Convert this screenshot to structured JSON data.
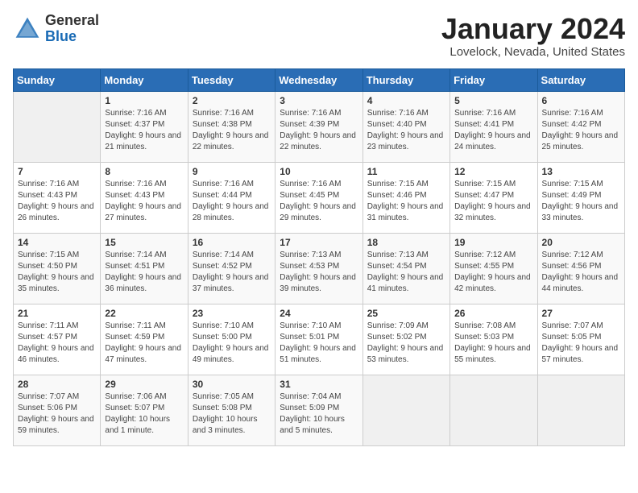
{
  "header": {
    "logo_general": "General",
    "logo_blue": "Blue",
    "month": "January 2024",
    "location": "Lovelock, Nevada, United States"
  },
  "days_of_week": [
    "Sunday",
    "Monday",
    "Tuesday",
    "Wednesday",
    "Thursday",
    "Friday",
    "Saturday"
  ],
  "weeks": [
    [
      {
        "day": "",
        "sunrise": "",
        "sunset": "",
        "daylight": ""
      },
      {
        "day": "1",
        "sunrise": "7:16 AM",
        "sunset": "4:37 PM",
        "daylight": "9 hours and 21 minutes."
      },
      {
        "day": "2",
        "sunrise": "7:16 AM",
        "sunset": "4:38 PM",
        "daylight": "9 hours and 22 minutes."
      },
      {
        "day": "3",
        "sunrise": "7:16 AM",
        "sunset": "4:39 PM",
        "daylight": "9 hours and 22 minutes."
      },
      {
        "day": "4",
        "sunrise": "7:16 AM",
        "sunset": "4:40 PM",
        "daylight": "9 hours and 23 minutes."
      },
      {
        "day": "5",
        "sunrise": "7:16 AM",
        "sunset": "4:41 PM",
        "daylight": "9 hours and 24 minutes."
      },
      {
        "day": "6",
        "sunrise": "7:16 AM",
        "sunset": "4:42 PM",
        "daylight": "9 hours and 25 minutes."
      }
    ],
    [
      {
        "day": "7",
        "sunrise": "7:16 AM",
        "sunset": "4:43 PM",
        "daylight": "9 hours and 26 minutes."
      },
      {
        "day": "8",
        "sunrise": "7:16 AM",
        "sunset": "4:43 PM",
        "daylight": "9 hours and 27 minutes."
      },
      {
        "day": "9",
        "sunrise": "7:16 AM",
        "sunset": "4:44 PM",
        "daylight": "9 hours and 28 minutes."
      },
      {
        "day": "10",
        "sunrise": "7:16 AM",
        "sunset": "4:45 PM",
        "daylight": "9 hours and 29 minutes."
      },
      {
        "day": "11",
        "sunrise": "7:15 AM",
        "sunset": "4:46 PM",
        "daylight": "9 hours and 31 minutes."
      },
      {
        "day": "12",
        "sunrise": "7:15 AM",
        "sunset": "4:47 PM",
        "daylight": "9 hours and 32 minutes."
      },
      {
        "day": "13",
        "sunrise": "7:15 AM",
        "sunset": "4:49 PM",
        "daylight": "9 hours and 33 minutes."
      }
    ],
    [
      {
        "day": "14",
        "sunrise": "7:15 AM",
        "sunset": "4:50 PM",
        "daylight": "9 hours and 35 minutes."
      },
      {
        "day": "15",
        "sunrise": "7:14 AM",
        "sunset": "4:51 PM",
        "daylight": "9 hours and 36 minutes."
      },
      {
        "day": "16",
        "sunrise": "7:14 AM",
        "sunset": "4:52 PM",
        "daylight": "9 hours and 37 minutes."
      },
      {
        "day": "17",
        "sunrise": "7:13 AM",
        "sunset": "4:53 PM",
        "daylight": "9 hours and 39 minutes."
      },
      {
        "day": "18",
        "sunrise": "7:13 AM",
        "sunset": "4:54 PM",
        "daylight": "9 hours and 41 minutes."
      },
      {
        "day": "19",
        "sunrise": "7:12 AM",
        "sunset": "4:55 PM",
        "daylight": "9 hours and 42 minutes."
      },
      {
        "day": "20",
        "sunrise": "7:12 AM",
        "sunset": "4:56 PM",
        "daylight": "9 hours and 44 minutes."
      }
    ],
    [
      {
        "day": "21",
        "sunrise": "7:11 AM",
        "sunset": "4:57 PM",
        "daylight": "9 hours and 46 minutes."
      },
      {
        "day": "22",
        "sunrise": "7:11 AM",
        "sunset": "4:59 PM",
        "daylight": "9 hours and 47 minutes."
      },
      {
        "day": "23",
        "sunrise": "7:10 AM",
        "sunset": "5:00 PM",
        "daylight": "9 hours and 49 minutes."
      },
      {
        "day": "24",
        "sunrise": "7:10 AM",
        "sunset": "5:01 PM",
        "daylight": "9 hours and 51 minutes."
      },
      {
        "day": "25",
        "sunrise": "7:09 AM",
        "sunset": "5:02 PM",
        "daylight": "9 hours and 53 minutes."
      },
      {
        "day": "26",
        "sunrise": "7:08 AM",
        "sunset": "5:03 PM",
        "daylight": "9 hours and 55 minutes."
      },
      {
        "day": "27",
        "sunrise": "7:07 AM",
        "sunset": "5:05 PM",
        "daylight": "9 hours and 57 minutes."
      }
    ],
    [
      {
        "day": "28",
        "sunrise": "7:07 AM",
        "sunset": "5:06 PM",
        "daylight": "9 hours and 59 minutes."
      },
      {
        "day": "29",
        "sunrise": "7:06 AM",
        "sunset": "5:07 PM",
        "daylight": "10 hours and 1 minute."
      },
      {
        "day": "30",
        "sunrise": "7:05 AM",
        "sunset": "5:08 PM",
        "daylight": "10 hours and 3 minutes."
      },
      {
        "day": "31",
        "sunrise": "7:04 AM",
        "sunset": "5:09 PM",
        "daylight": "10 hours and 5 minutes."
      },
      {
        "day": "",
        "sunrise": "",
        "sunset": "",
        "daylight": ""
      },
      {
        "day": "",
        "sunrise": "",
        "sunset": "",
        "daylight": ""
      },
      {
        "day": "",
        "sunrise": "",
        "sunset": "",
        "daylight": ""
      }
    ]
  ]
}
